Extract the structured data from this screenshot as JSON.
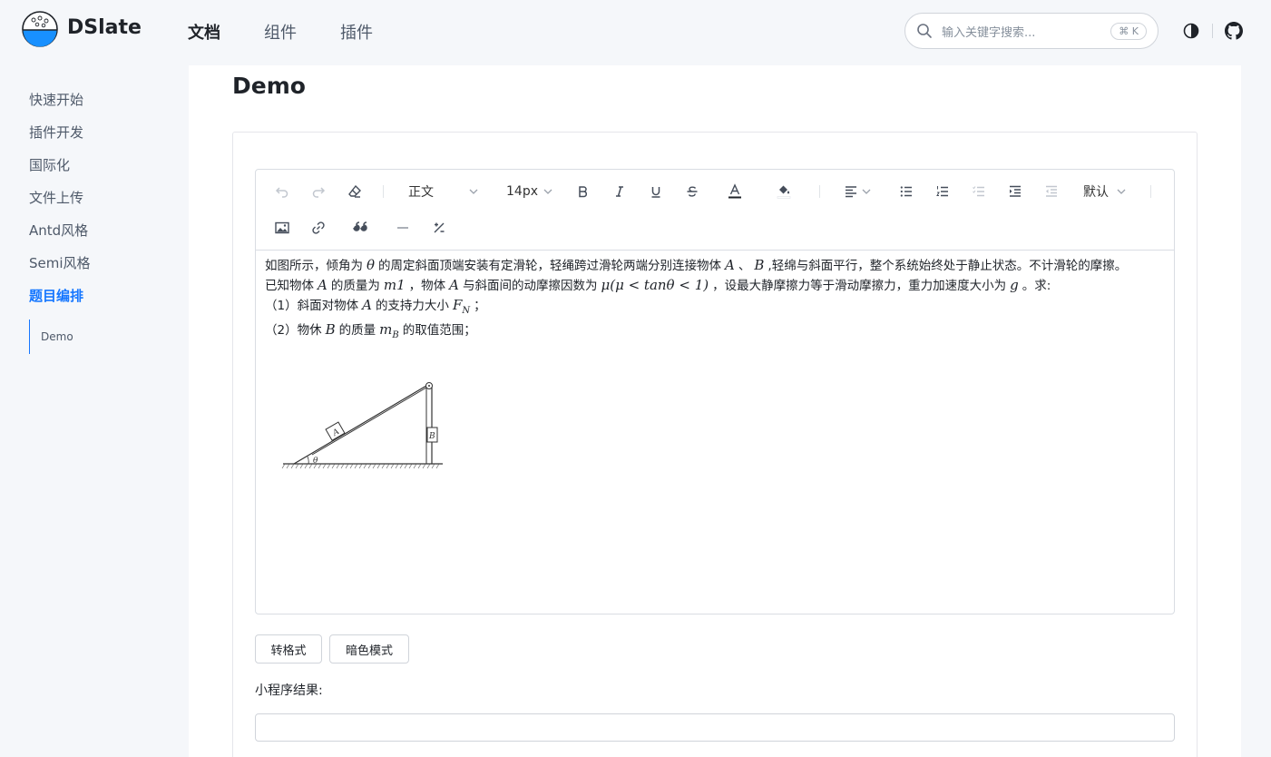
{
  "header": {
    "brand": "DSlate",
    "nav": [
      {
        "label": "文档",
        "active": true
      },
      {
        "label": "组件",
        "active": false
      },
      {
        "label": "插件",
        "active": false
      }
    ],
    "search": {
      "placeholder": "输入关键字搜索...",
      "shortcut": "⌘ K"
    },
    "icons": [
      "search-icon",
      "theme-toggle-icon",
      "github-icon"
    ]
  },
  "sidebar": {
    "items": [
      {
        "label": "快速开始"
      },
      {
        "label": "插件开发"
      },
      {
        "label": "国际化"
      },
      {
        "label": "文件上传"
      },
      {
        "label": "Antd风格"
      },
      {
        "label": "Semi风格"
      },
      {
        "label": "题目编排",
        "active": true
      }
    ],
    "sub_item": "Demo"
  },
  "main": {
    "title": "Demo"
  },
  "toolbar": {
    "paragraph": "正文",
    "font_size": "14px",
    "line_height": "默认"
  },
  "content": {
    "l1a": "如图所示，倾角为",
    "theta": "θ",
    "l1b": "的周定斜面顶端安装有定滑轮，轻绳跨过滑轮两端分别连接物体",
    "A": "A",
    "l1c": "、",
    "B": "B",
    "l1d": ",轻绵与斜面平行，整个系统始终处于静止状态。不计滑轮的摩擦。",
    "l2a": "已知物体",
    "l2b": "的质量为",
    "m1": "m1",
    "l2c": "，物体",
    "l2d": "与斜面间的动摩擦因数为",
    "mu": "μ(μ < tanθ < 1)",
    "l2e": "，设最大静摩擦力等于滑动摩擦力，重力加速度大小为",
    "g": "g",
    "l2f": "。求:",
    "l3a": "（1）斜面对物体",
    "l3b": "的支持力大小",
    "FN": "F",
    "FN_sub": "N",
    "l3c": "；",
    "l4a": "（2）物休",
    "l4b": "的质量",
    "mB": "m",
    "mB_sub": "B",
    "l4c": "的取值范围；",
    "fig_A": "A",
    "fig_B": "B",
    "fig_theta": "θ"
  },
  "buttons": {
    "convert": "转格式",
    "dark_mode": "暗色模式"
  },
  "result": {
    "label": "小程序结果:"
  }
}
